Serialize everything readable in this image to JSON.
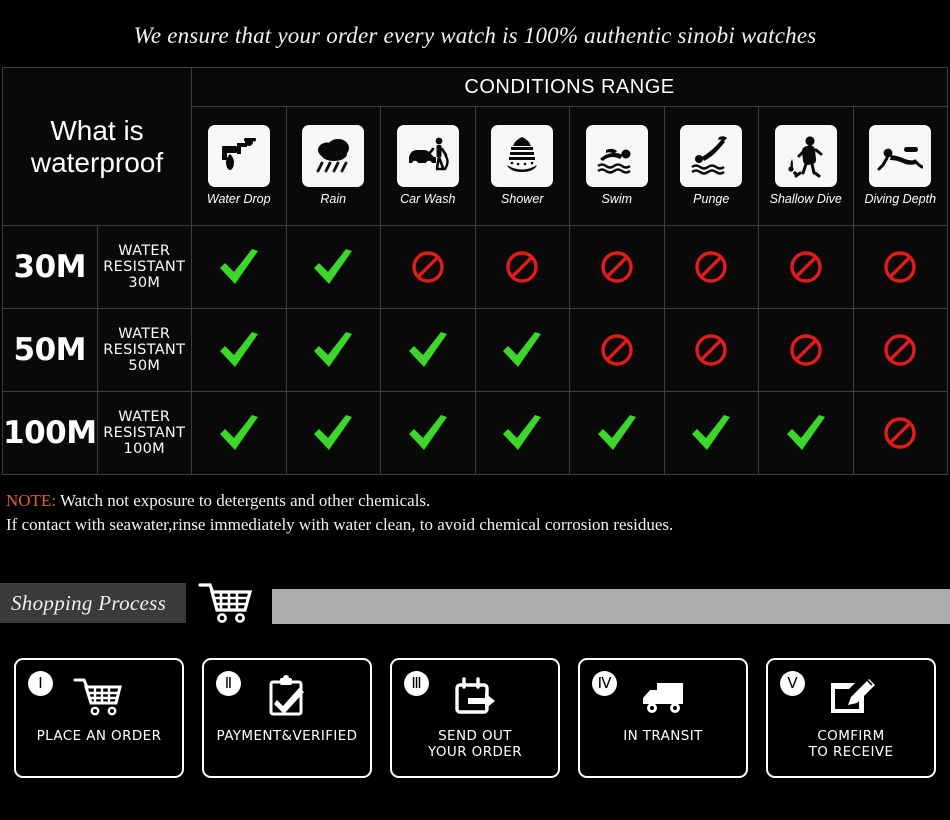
{
  "headline": "We ensure that your order every watch is 100% authentic sinobi watches",
  "table": {
    "title_cell": "What is waterproof",
    "conditions_header": "CONDITIONS RANGE",
    "columns": [
      {
        "label": "Water Drop",
        "icon": "faucet-water-drop-icon"
      },
      {
        "label": "Rain",
        "icon": "rain-cloud-icon"
      },
      {
        "label": "Car Wash",
        "icon": "car-wash-icon"
      },
      {
        "label": "Shower",
        "icon": "shower-icon"
      },
      {
        "label": "Swim",
        "icon": "swimmer-icon"
      },
      {
        "label": "Punge",
        "icon": "plunge-dive-icon"
      },
      {
        "label": "Shallow\nDive",
        "icon": "shallow-dive-icon"
      },
      {
        "label": "Diving\nDepth",
        "icon": "scuba-diver-icon"
      }
    ],
    "rows": [
      {
        "depth": "30M",
        "description": "WATER RESISTANT  30M",
        "marks": [
          "yes",
          "yes",
          "no",
          "no",
          "no",
          "no",
          "no",
          "no"
        ]
      },
      {
        "depth": "50M",
        "description": "WATER RESISTANT 50M",
        "marks": [
          "yes",
          "yes",
          "yes",
          "yes",
          "no",
          "no",
          "no",
          "no"
        ]
      },
      {
        "depth": "100M",
        "description": "WATER RESISTANT  100M",
        "marks": [
          "yes",
          "yes",
          "yes",
          "yes",
          "yes",
          "yes",
          "yes",
          "no"
        ]
      }
    ]
  },
  "note": {
    "tag": "NOTE:",
    "line1": " Watch not exposure to detergents and other chemicals.",
    "line2": "If contact with seawater,rinse immediately with water clean, to avoid chemical corrosion residues."
  },
  "shopping_process": {
    "label": "Shopping Process",
    "cart_icon": "shopping-cart-icon"
  },
  "steps": [
    {
      "numeral": "Ⅰ",
      "label": "PLACE AN ORDER",
      "icon": "shopping-cart-icon"
    },
    {
      "numeral": "Ⅱ",
      "label": "PAYMENT&VERIFIED",
      "icon": "clipboard-check-icon"
    },
    {
      "numeral": "Ⅲ",
      "label": "SEND OUT\nYOUR ORDER",
      "icon": "calendar-arrow-icon"
    },
    {
      "numeral": "Ⅳ",
      "label": "IN TRANSIT",
      "icon": "delivery-truck-icon"
    },
    {
      "numeral": "Ⅴ",
      "label": "COMFIRM\nTO RECEIVE",
      "icon": "edit-pencil-icon"
    }
  ],
  "colors": {
    "background": "#000000",
    "check_green": "#3dd62b",
    "forbidden_red": "#e31b1b",
    "note_accent": "#e2622a",
    "banner_gray": "#adadad",
    "banner_dark": "#3b3b3b"
  }
}
